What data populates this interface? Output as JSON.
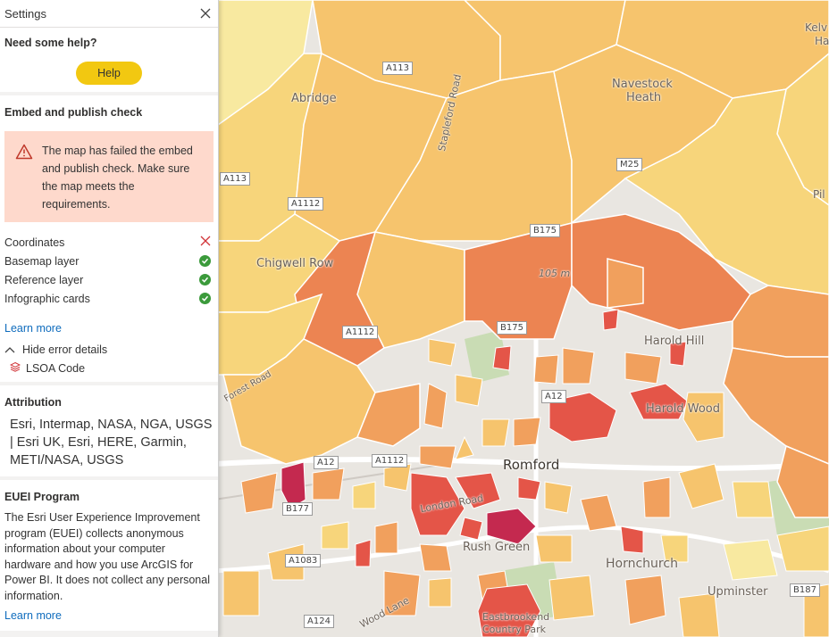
{
  "panel": {
    "title": "Settings",
    "help_section": {
      "heading": "Need some help?",
      "button_label": "Help"
    },
    "embed_section": {
      "heading": "Embed and publish check",
      "error_message": "The map has failed the embed and publish check. Make sure the map meets the requirements.",
      "checks": [
        {
          "label": "Coordinates",
          "status": "fail"
        },
        {
          "label": "Basemap layer",
          "status": "pass"
        },
        {
          "label": "Reference layer",
          "status": "pass"
        },
        {
          "label": "Infographic cards",
          "status": "pass"
        }
      ],
      "learn_more": "Learn more",
      "hide_details": "Hide error details",
      "error_layer": "LSOA Code"
    },
    "attribution_section": {
      "heading": "Attribution",
      "text": "Esri, Intermap, NASA, NGA, USGS | Esri UK, Esri, HERE, Garmin, METI/NASA, USGS"
    },
    "euei_section": {
      "heading": "EUEI Program",
      "text": "The Esri User Experience Improvement program (EUEI) collects anonymous information about your computer hardware and how you use ArcGIS for Power BI. It does not collect any personal information.",
      "learn_more": "Learn more"
    }
  },
  "map": {
    "places": {
      "abridge": "Abridge",
      "navestock": "Navestock",
      "heath": "Heath",
      "chigwell_row": "Chigwell Row",
      "romford": "Romford",
      "rush_green": "Rush Green",
      "hornchurch": "Hornchurch",
      "harold_hill": "Harold Hill",
      "harold_wood": "Harold Wood",
      "upminster": "Upminster",
      "eastbrookend": "Eastbrookend",
      "country_park": "Country Park",
      "kelv_partial": "Kelv",
      "ha_partial": "Ha",
      "pil_partial": "Pil",
      "elevation": "105 m"
    },
    "roads": {
      "stapleford_road": "Stapleford Road",
      "london_road": "London Road",
      "wood_lane": "Wood Lane",
      "forest_road_partial": "Forest Road"
    },
    "shields": {
      "a113_top": "A113",
      "a113_left": "A113",
      "a1112_top": "A1112",
      "m25": "M25",
      "b175_a": "B175",
      "b175_b": "B175",
      "a1112_mid": "A1112",
      "a12_a": "A12",
      "a12_b": "A12",
      "a1112_bottom": "A1112",
      "b177": "B177",
      "a1083": "A1083",
      "a124": "A124",
      "b187": "B187"
    },
    "colors": {
      "light_yellow": "#f8e9a0",
      "yellow": "#f7d57b",
      "light_orange": "#f6c46d",
      "orange": "#f1a05d",
      "dark_orange": "#ec8452",
      "red": "#e45548",
      "dark_red": "#c4294f",
      "basemap": "#e9e6e1",
      "road": "#ffffff",
      "park": "#c9dcb4"
    }
  }
}
